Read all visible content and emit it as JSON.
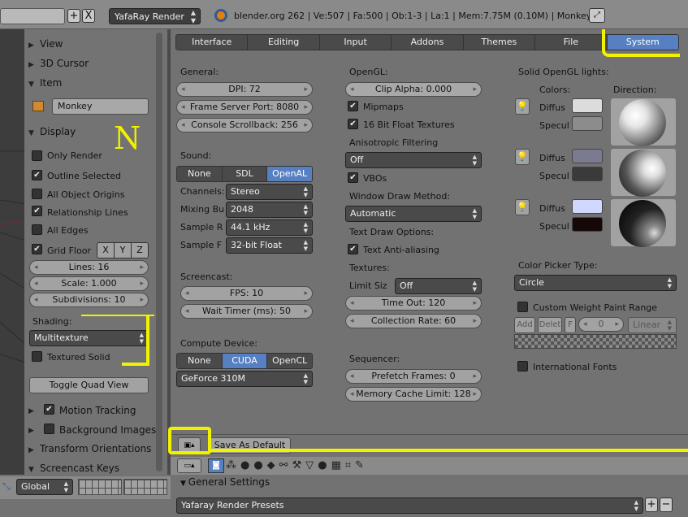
{
  "header": {
    "render_engine": "YafaRay Render",
    "info": "blender.org 262 | Ve:507 | Fa:500 | Ob:1-3 | La:1 | Mem:7.75M (0.10M) | Monkey",
    "add_label": "+",
    "close_label": "X"
  },
  "npanel": {
    "sections": {
      "view": "View",
      "cursor": "3D Cursor",
      "item": "Item",
      "display": "Display"
    },
    "item_name": "Monkey",
    "annotation": "N",
    "display": {
      "only_render": "Only Render",
      "outline_selected": "Outline Selected",
      "all_object_origins": "All Object Origins",
      "relationship_lines": "Relationship Lines",
      "all_edges": "All Edges",
      "grid_floor": "Grid Floor",
      "x": "X",
      "y": "Y",
      "z": "Z",
      "lines": "Lines: 16",
      "scale": "Scale: 1.000",
      "subdivisions": "Subdivisions: 10"
    },
    "shading_label": "Shading:",
    "shading_value": "Multitexture",
    "textured_solid": "Textured Solid",
    "toggle_quad": "Toggle Quad View",
    "motion_tracking": "Motion Tracking",
    "background_images": "Background Images",
    "transform_orientations": "Transform Orientations",
    "screencast_keys": "Screencast Keys"
  },
  "tabs": [
    "Interface",
    "Editing",
    "Input",
    "Addons",
    "Themes",
    "File",
    "System"
  ],
  "active_tab": "System",
  "general": {
    "label": "General:",
    "dpi": "DPI: 72",
    "frame_server": "Frame Server Port: 8080",
    "console": "Console Scrollback: 256"
  },
  "sound": {
    "label": "Sound:",
    "options": [
      "None",
      "SDL",
      "OpenAL"
    ],
    "selected": "OpenAL",
    "channels_label": "Channels:",
    "channels": "Stereo",
    "mixing_label": "Mixing Bu",
    "mixing": "2048",
    "sample_rate_label": "Sample R",
    "sample_rate": "44.1 kHz",
    "sample_format_label": "Sample F",
    "sample_format": "32-bit Float"
  },
  "screencast": {
    "label": "Screencast:",
    "fps": "FPS: 10",
    "wait": "Wait Timer (ms): 50"
  },
  "compute": {
    "label": "Compute Device:",
    "options": [
      "None",
      "CUDA",
      "OpenCL"
    ],
    "selected": "CUDA",
    "device": "GeForce 310M"
  },
  "opengl": {
    "label": "OpenGL:",
    "clip_alpha": "Clip Alpha: 0.000",
    "mipmaps": "Mipmaps",
    "float_textures": "16 Bit Float Textures",
    "aniso_label": "Anisotropic Filtering",
    "aniso_value": "Off",
    "vbos": "VBOs",
    "window_draw_label": "Window Draw Method:",
    "window_draw_value": "Automatic",
    "text_draw_label": "Text Draw Options:",
    "antialias": "Text Anti-aliasing",
    "textures_label": "Textures:",
    "limit_label": "Limit Siz",
    "limit_value": "Off",
    "timeout": "Time Out: 120",
    "collection": "Collection Rate: 60"
  },
  "sequencer": {
    "label": "Sequencer:",
    "prefetch": "Prefetch Frames: 0",
    "memory": "Memory Cache Limit: 128"
  },
  "lights": {
    "label": "Solid OpenGL lights:",
    "colors_label": "Colors:",
    "direction_label": "Direction:",
    "diffuse": "Diffus",
    "specular": "Specul",
    "light1_diffuse": "#dcdcdc",
    "light1_spec": "#8c8c8c",
    "light2_diffuse": "#7a7a90",
    "light2_spec": "#3a3a3a",
    "light3_diffuse": "#d0d8ff",
    "light3_spec": "#140808"
  },
  "color_picker": {
    "label": "Color Picker Type:",
    "value": "Circle"
  },
  "weight": {
    "label": "Custom Weight Paint Range",
    "add": "Add",
    "delete": "Delet",
    "f": "F",
    "value": "0",
    "interp": "Linear"
  },
  "international": "International Fonts",
  "save_default": "Save As Default",
  "bottom": {
    "general_settings": "General Settings",
    "presets": "Yafaray Render Presets",
    "orientation": "Global"
  }
}
